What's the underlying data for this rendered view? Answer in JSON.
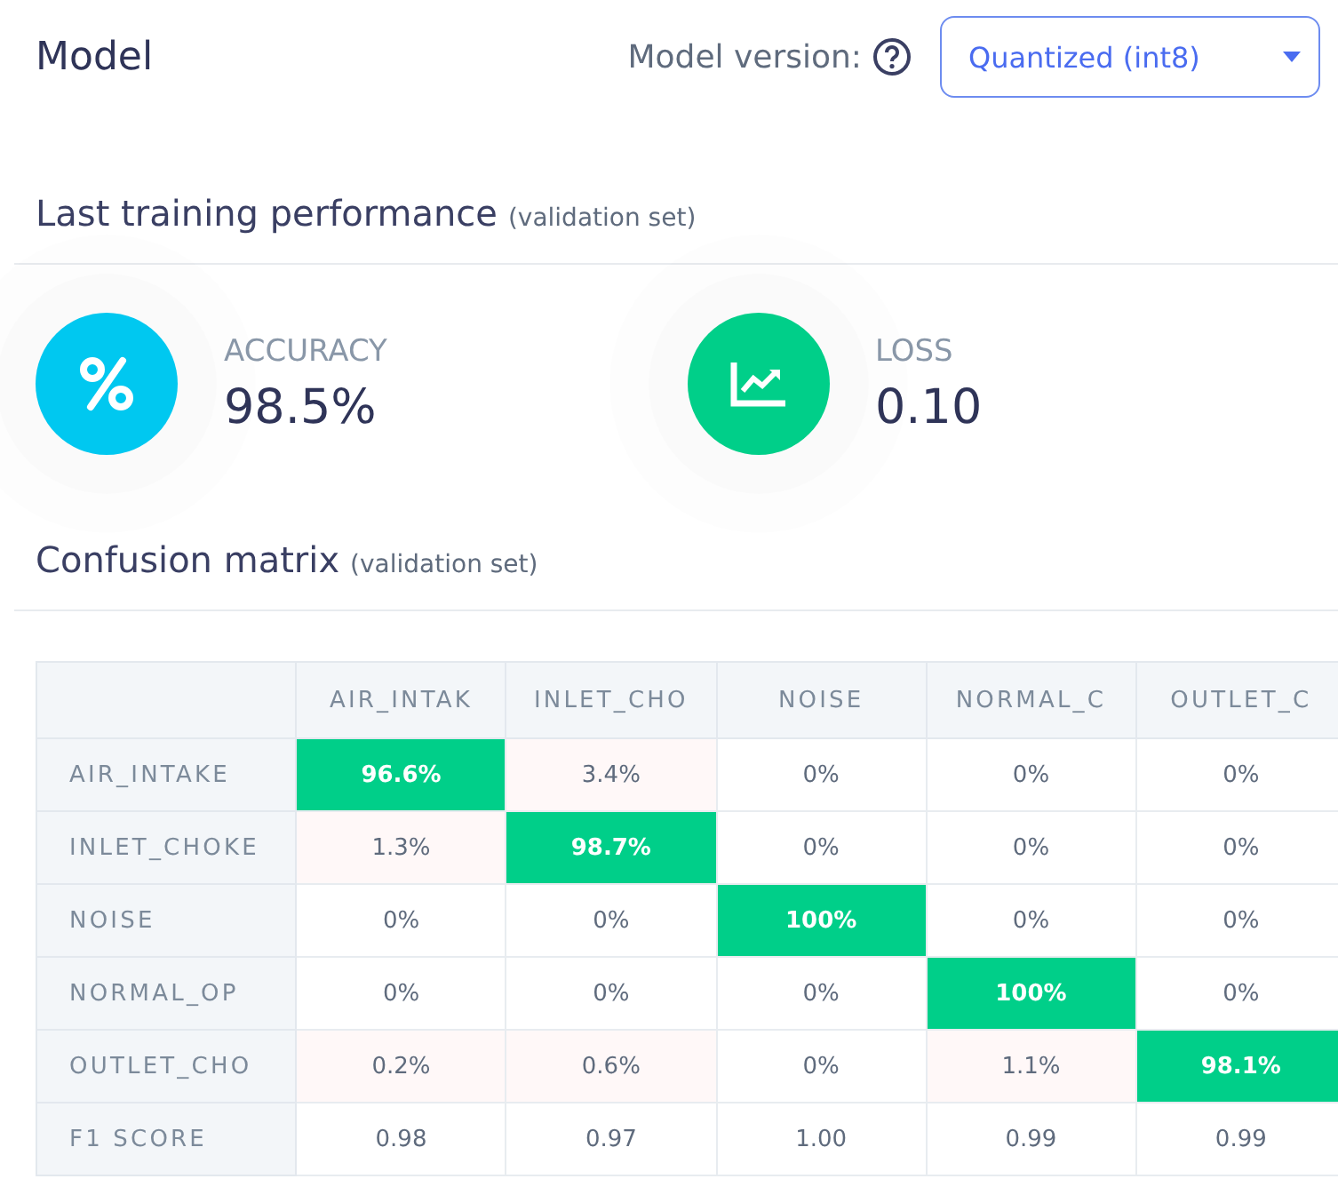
{
  "header": {
    "title": "Model",
    "version_label": "Model version:",
    "version_select": "Quantized (int8)"
  },
  "performance": {
    "title": "Last training performance",
    "note": "(validation set)",
    "metrics": [
      {
        "kind": "percent",
        "label": "ACCURACY",
        "value": "98.5%",
        "color": "#00c8f0"
      },
      {
        "kind": "chart",
        "label": "LOSS",
        "value": "0.10",
        "color": "#00cf89"
      }
    ]
  },
  "confusion": {
    "title": "Confusion matrix",
    "note": "(validation set)",
    "columns": [
      "AIR_INTAK",
      "INLET_CHO",
      "NOISE",
      "NORMAL_C",
      "OUTLET_C"
    ],
    "rows": [
      {
        "label": "AIR_INTAKE",
        "cells": [
          {
            "value": "96.6%",
            "kind": "correct"
          },
          {
            "value": "3.4%",
            "kind": "error"
          },
          {
            "value": "0%",
            "kind": "zero"
          },
          {
            "value": "0%",
            "kind": "zero"
          },
          {
            "value": "0%",
            "kind": "zero"
          }
        ]
      },
      {
        "label": "INLET_CHOKE",
        "cells": [
          {
            "value": "1.3%",
            "kind": "error"
          },
          {
            "value": "98.7%",
            "kind": "correct"
          },
          {
            "value": "0%",
            "kind": "zero"
          },
          {
            "value": "0%",
            "kind": "zero"
          },
          {
            "value": "0%",
            "kind": "zero"
          }
        ]
      },
      {
        "label": "NOISE",
        "cells": [
          {
            "value": "0%",
            "kind": "zero"
          },
          {
            "value": "0%",
            "kind": "zero"
          },
          {
            "value": "100%",
            "kind": "correct"
          },
          {
            "value": "0%",
            "kind": "zero"
          },
          {
            "value": "0%",
            "kind": "zero"
          }
        ]
      },
      {
        "label": "NORMAL_OP",
        "cells": [
          {
            "value": "0%",
            "kind": "zero"
          },
          {
            "value": "0%",
            "kind": "zero"
          },
          {
            "value": "0%",
            "kind": "zero"
          },
          {
            "value": "100%",
            "kind": "correct"
          },
          {
            "value": "0%",
            "kind": "zero"
          }
        ]
      },
      {
        "label": "OUTLET_CHO",
        "cells": [
          {
            "value": "0.2%",
            "kind": "error"
          },
          {
            "value": "0.6%",
            "kind": "error"
          },
          {
            "value": "0%",
            "kind": "zero"
          },
          {
            "value": "1.1%",
            "kind": "error"
          },
          {
            "value": "98.1%",
            "kind": "correct"
          }
        ]
      },
      {
        "label": "F1 SCORE",
        "cells": [
          {
            "value": "0.98",
            "kind": "score"
          },
          {
            "value": "0.97",
            "kind": "score"
          },
          {
            "value": "1.00",
            "kind": "score"
          },
          {
            "value": "0.99",
            "kind": "score"
          },
          {
            "value": "0.99",
            "kind": "score"
          }
        ]
      }
    ]
  }
}
